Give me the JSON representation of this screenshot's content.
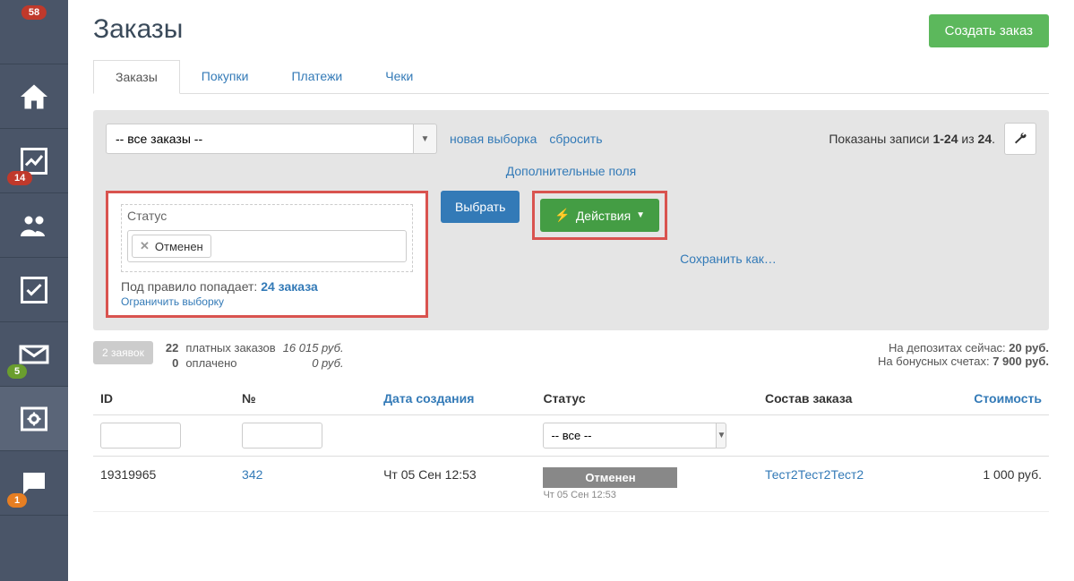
{
  "sidebar": {
    "badges": {
      "top": "58",
      "chart": "14",
      "mail": "5",
      "chat": "1"
    }
  },
  "header": {
    "title": "Заказы",
    "create": "Создать заказ"
  },
  "tabs": [
    {
      "label": "Заказы",
      "active": true
    },
    {
      "label": "Покупки"
    },
    {
      "label": "Платежи"
    },
    {
      "label": "Чеки"
    }
  ],
  "filter": {
    "select_value": "-- все заказы --",
    "new_selection": "новая выборка",
    "reset": "сбросить",
    "records_prefix": "Показаны записи ",
    "records_range": "1-24",
    "records_mid": " из ",
    "records_total": "24",
    "extra_fields": "Дополнительные поля",
    "status_label": "Статус",
    "status_tag": "Отменен",
    "rule_text": "Под правило попадает: ",
    "rule_count": "24 заказа",
    "limit": "Ограничить выборку",
    "select_btn": "Выбрать",
    "actions_btn": "Действия",
    "save_as": "Сохранить как…"
  },
  "stats": {
    "requests": "2 заявок",
    "paid_count": "22",
    "paid_label": "платных заказов",
    "paid_sum": "16 015 руб.",
    "done_count": "0",
    "done_label": "оплачено",
    "done_sum": "0 руб.",
    "deposits_label": "На депозитах сейчас: ",
    "deposits_val": "20 руб.",
    "bonus_label": "На бонусных счетах: ",
    "bonus_val": "7 900 руб."
  },
  "table": {
    "headers": {
      "id": "ID",
      "no": "№",
      "date": "Дата создания",
      "status": "Статус",
      "content": "Состав заказа",
      "cost": "Стоимость"
    },
    "status_filter": "-- все --",
    "rows": [
      {
        "id": "19319965",
        "no": "342",
        "date": "Чт 05 Сен 12:53",
        "status": "Отменен",
        "status_date": "Чт 05 Сен 12:53",
        "content": "Тест2Тест2Тест2",
        "cost": "1 000 руб."
      }
    ]
  }
}
